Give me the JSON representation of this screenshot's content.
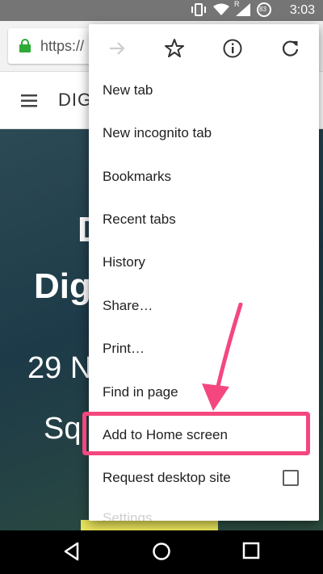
{
  "status_bar": {
    "time": "3:03",
    "battery_level": "83",
    "signal_label": "R"
  },
  "toolbar": {
    "url": "https://",
    "lock_icon": "lock-icon"
  },
  "site_header": {
    "brand": "DIG"
  },
  "hero": {
    "line1": "D",
    "line2": "Dig",
    "line3": "29 N",
    "line4": "Sq"
  },
  "menu": {
    "icons": [
      "forward-arrow-icon",
      "star-icon",
      "info-icon",
      "reload-icon"
    ],
    "items": [
      {
        "label": "New tab"
      },
      {
        "label": "New incognito tab"
      },
      {
        "label": "Bookmarks"
      },
      {
        "label": "Recent tabs"
      },
      {
        "label": "History"
      },
      {
        "label": "Share…"
      },
      {
        "label": "Print…"
      },
      {
        "label": "Find in page"
      },
      {
        "label": "Add to Home screen",
        "highlighted": true
      },
      {
        "label": "Request desktop site",
        "checkbox": false
      },
      {
        "label": "Settings"
      }
    ]
  },
  "colors": {
    "highlight": "#f4477f",
    "status_bar": "#757575",
    "lock": "#2eaa36"
  }
}
